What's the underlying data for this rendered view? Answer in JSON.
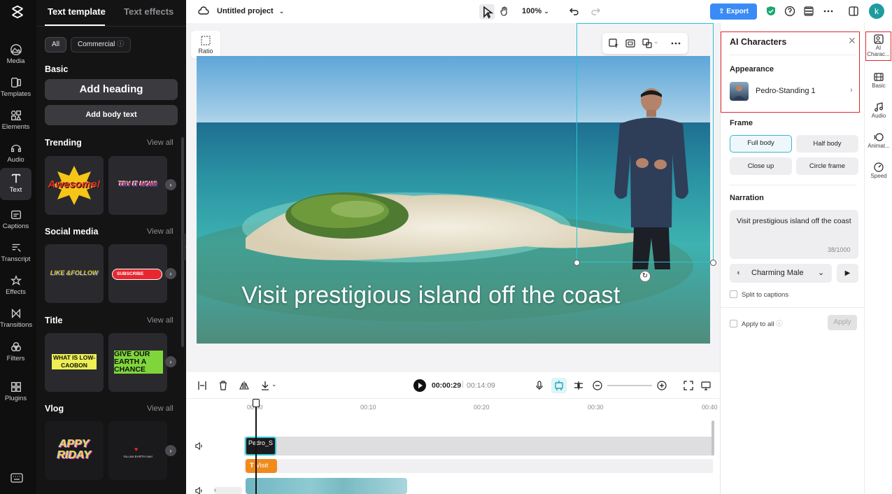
{
  "left_rail": {
    "items": [
      {
        "label": "Media",
        "icon": "media-icon"
      },
      {
        "label": "Templates",
        "icon": "templates-icon"
      },
      {
        "label": "Elements",
        "icon": "elements-icon"
      },
      {
        "label": "Audio",
        "icon": "audio-icon"
      },
      {
        "label": "Text",
        "icon": "text-icon"
      },
      {
        "label": "Captions",
        "icon": "captions-icon"
      },
      {
        "label": "Transcript",
        "icon": "transcript-icon"
      },
      {
        "label": "Effects",
        "icon": "effects-icon"
      },
      {
        "label": "Transitions",
        "icon": "transitions-icon"
      },
      {
        "label": "Filters",
        "icon": "filters-icon"
      },
      {
        "label": "Plugins",
        "icon": "plugins-icon"
      }
    ],
    "active": "Text"
  },
  "text_panel": {
    "tabs": [
      "Text template",
      "Text effects"
    ],
    "chips": {
      "all": "All",
      "commercial": "Commercial"
    },
    "basic": {
      "title": "Basic",
      "add_heading": "Add heading",
      "add_body": "Add body text"
    },
    "sections": [
      {
        "title": "Trending",
        "view_all": "View all",
        "cards": [
          "Awesome!",
          "TRY IT NOW!"
        ]
      },
      {
        "title": "Social media",
        "view_all": "View all",
        "cards": [
          "LIKE &FOLLOW",
          "SUBSCRIBE"
        ]
      },
      {
        "title": "Title",
        "view_all": "View all",
        "cards": [
          "WHAT IS LOW-CAOBON",
          "GIVE OUR EARTH A CHANCE"
        ]
      },
      {
        "title": "Vlog",
        "view_all": "View all",
        "cards": [
          "APPY RIDAY",
          "You are EARTH one!"
        ]
      }
    ]
  },
  "topbar": {
    "project_name": "Untitled project",
    "zoom": "100%",
    "export_label": "Export",
    "avatar_letter": "k"
  },
  "canvas": {
    "ratio_label": "Ratio",
    "caption": "Visit prestigious island off the coast"
  },
  "timeline": {
    "current_time": "00:00:29",
    "total_time": "00:14:09",
    "ticks": [
      "00:00",
      "00:10",
      "00:20",
      "00:30",
      "00:40"
    ],
    "clips": {
      "avatar": "Pedro_S",
      "text": "Visit"
    }
  },
  "properties": {
    "title": "AI Characters",
    "appearance_label": "Appearance",
    "character_name": "Pedro-Standing 1",
    "frame_label": "Frame",
    "frame_options": [
      "Full body",
      "Half body",
      "Close up",
      "Circle frame"
    ],
    "frame_selected": "Full body",
    "narration_label": "Narration",
    "narration_text": "Visit prestigious island off the coast",
    "narration_count": "38/1000",
    "voice": "Charming Male",
    "split_captions": "Split to captions",
    "apply_to_all": "Apply to all",
    "apply_button": "Apply"
  },
  "right_rail": {
    "items": [
      {
        "label": "AI Charac...",
        "icon": "ai-character-icon"
      },
      {
        "label": "Basic",
        "icon": "basic-icon"
      },
      {
        "label": "Audio",
        "icon": "audio-icon"
      },
      {
        "label": "Animat...",
        "icon": "animation-icon"
      },
      {
        "label": "Speed",
        "icon": "speed-icon"
      }
    ]
  },
  "colors": {
    "accent": "#3a8bf5",
    "selection": "#2bc4d2",
    "highlight_box": "#e0282f",
    "text_clip": "#f08a1d"
  }
}
